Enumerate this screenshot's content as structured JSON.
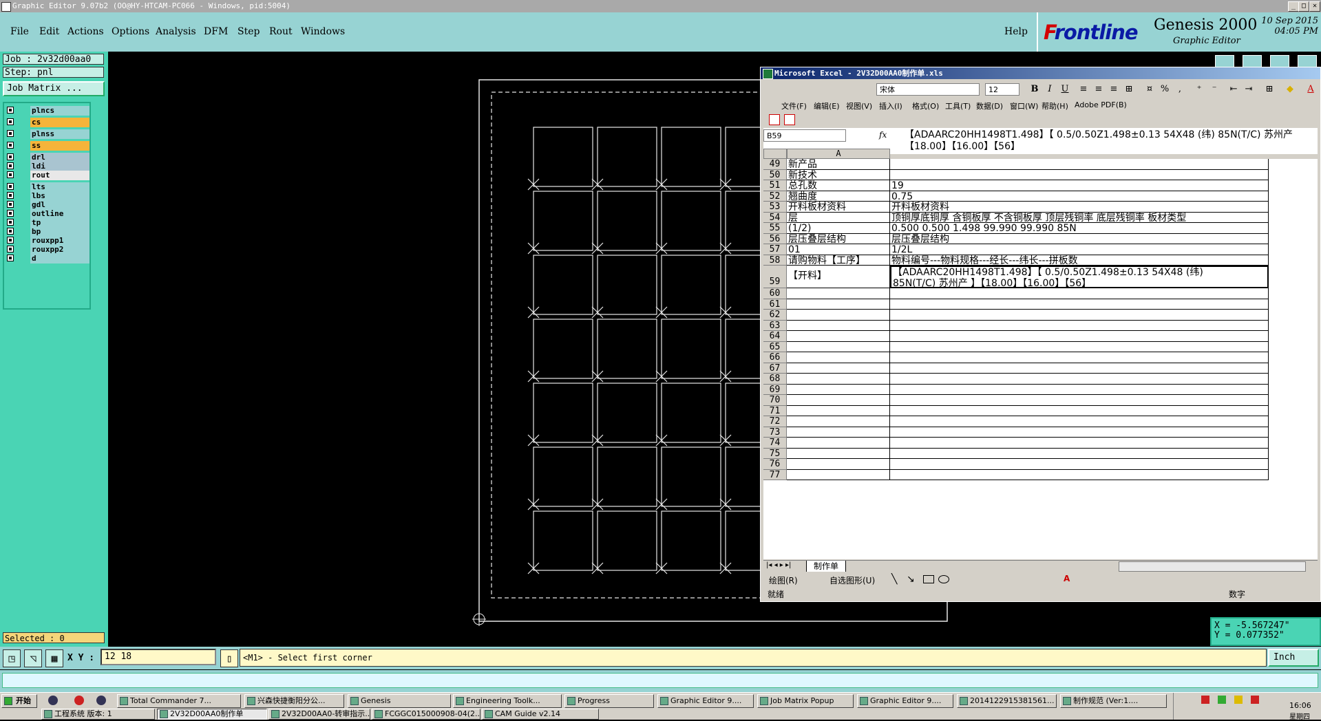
{
  "window": {
    "title": "Graphic Editor 9.07b2 (OO@HY-HTCAM-PC066 - Windows, pid:5004)",
    "min": "_",
    "max": "□",
    "close": "✕"
  },
  "menu": {
    "file": "File",
    "edit": "Edit",
    "actions": "Actions",
    "options": "Options",
    "analysis": "Analysis",
    "dfm": "DFM",
    "step": "Step",
    "rout": "Rout",
    "windows": "Windows",
    "help": "Help"
  },
  "brand": {
    "logo_f": "F",
    "logo_rest": "rontline",
    "product": "Genesis 2000",
    "subtitle": "Graphic Editor",
    "date": "10 Sep 2015",
    "time": "04:05 PM"
  },
  "left": {
    "job": "Job : 2v32d00aa0",
    "step": "Step: pnl",
    "job_matrix": "Job Matrix ...",
    "layers": [
      {
        "name": "plncs",
        "color": "#97d3d3"
      },
      {
        "name": "cs",
        "color": "#f5b43a"
      },
      {
        "name": "plnss",
        "color": "#97d3d3"
      },
      {
        "name": "ss",
        "color": "#f5b43a"
      },
      {
        "name": "drl",
        "color": "#a9c4d0"
      },
      {
        "name": "ldi",
        "color": "#a9c4d0"
      },
      {
        "name": "rout",
        "color": "#e8e8e8"
      },
      {
        "name": "lts",
        "color": "#97d3d3"
      },
      {
        "name": "lbs",
        "color": "#97d3d3"
      },
      {
        "name": "gdl",
        "color": "#97d3d3"
      },
      {
        "name": "outline",
        "color": "#97d3d3"
      },
      {
        "name": "tp",
        "color": "#97d3d3"
      },
      {
        "name": "bp",
        "color": "#97d3d3"
      },
      {
        "name": "rouxpp1",
        "color": "#97d3d3"
      },
      {
        "name": "rouxpp2",
        "color": "#97d3d3"
      },
      {
        "name": "d",
        "color": "#97d3d3"
      }
    ],
    "selected": "Selected : 0"
  },
  "excel": {
    "title": "Microsoft Excel - 2V32D00AA0制作单.xls",
    "font": "宋体",
    "size": "12",
    "menus": [
      "文件(F)",
      "编辑(E)",
      "视图(V)",
      "插入(I)",
      "格式(O)",
      "工具(T)",
      "数据(D)",
      "窗口(W)",
      "帮助(H)",
      "Adobe PDF(B)"
    ],
    "namebox": "B59",
    "fx": "fx",
    "formula_line1": "【ADAARC20HH1498T1.498】【 0.5/0.50Z1.498±0.13 54X48 (纬)   85N(T/C) 苏州产",
    "formula_line2": "【18.00】【16.00】【56】",
    "col_a": "A",
    "rows": [
      {
        "n": "49",
        "a": "新产品",
        "b": ""
      },
      {
        "n": "50",
        "a": "新技术",
        "b": ""
      },
      {
        "n": "51",
        "a": "总孔数",
        "b": "19"
      },
      {
        "n": "52",
        "a": "翘曲度",
        "b": "0.75"
      },
      {
        "n": "53",
        "a": "开料板材资料",
        "b": "开料板材资料"
      },
      {
        "n": "54",
        "a": "层",
        "b": "顶铜厚底铜厚 含铜板厚 不含铜板厚 顶层残铜率 底层残铜率 板材类型"
      },
      {
        "n": "55",
        "a": "(1/2)",
        "b": "0.500  0.500          1.498       99.990     99.990       85N"
      },
      {
        "n": "56",
        "a": "层压叠层结构",
        "b": "层压叠层结构"
      },
      {
        "n": "57",
        "a": "01",
        "b": "1/2L"
      },
      {
        "n": "58",
        "a": "请购物料【工序】",
        "b": "物料编号---物料规格---经长---纬长---拼板数"
      },
      {
        "n": "59",
        "a": "【开料】",
        "b": "【ADAARC20HH1498T1.498】【 0.5/0.50Z1.498±0.13 54X48 (纬)",
        "b2": "85N(T/C) 苏州产 】【18.00】【16.00】【56】"
      },
      {
        "n": "60",
        "a": "",
        "b": ""
      },
      {
        "n": "61",
        "a": "",
        "b": ""
      },
      {
        "n": "62",
        "a": "",
        "b": ""
      },
      {
        "n": "63",
        "a": "",
        "b": ""
      },
      {
        "n": "64",
        "a": "",
        "b": ""
      },
      {
        "n": "65",
        "a": "",
        "b": ""
      },
      {
        "n": "66",
        "a": "",
        "b": ""
      },
      {
        "n": "67",
        "a": "",
        "b": ""
      },
      {
        "n": "68",
        "a": "",
        "b": ""
      },
      {
        "n": "69",
        "a": "",
        "b": ""
      },
      {
        "n": "70",
        "a": "",
        "b": ""
      },
      {
        "n": "71",
        "a": "",
        "b": ""
      },
      {
        "n": "72",
        "a": "",
        "b": ""
      },
      {
        "n": "73",
        "a": "",
        "b": ""
      },
      {
        "n": "74",
        "a": "",
        "b": ""
      },
      {
        "n": "75",
        "a": "",
        "b": ""
      },
      {
        "n": "76",
        "a": "",
        "b": ""
      },
      {
        "n": "77",
        "a": "",
        "b": ""
      }
    ],
    "sheet_tab": "制作单",
    "draw_label": "绘图(R)",
    "autoshape_label": "自选图形(U)",
    "status_ready": "就绪",
    "status_num": "数字"
  },
  "coords": {
    "x": "X = -5.567247\"",
    "y": "Y = 0.077352\""
  },
  "cmd": {
    "xy_label": "X Y :",
    "xy_value": "12 18",
    "prompt": "<M1> - Select first corner",
    "units": "Inch"
  },
  "taskbar": {
    "start": "开始",
    "tasks": [
      "Total Commander 7...",
      "兴森快捷衡阳分公...",
      "Genesis",
      "Engineering Toolk...",
      "Progress",
      "Graphic Editor 9....",
      "Job Matrix Popup",
      "Graphic Editor 9....",
      "2014122915381561...",
      "制作规范 (Ver:1...."
    ],
    "tasks2": [
      "工程系统   版本: 1",
      "2V32D00AA0制作单",
      "2V32D00AA0-转审指示...",
      "FCGGC015000908-04(2...",
      "CAM Guide v2.14"
    ],
    "clock": "16:06",
    "day": "星期四"
  }
}
